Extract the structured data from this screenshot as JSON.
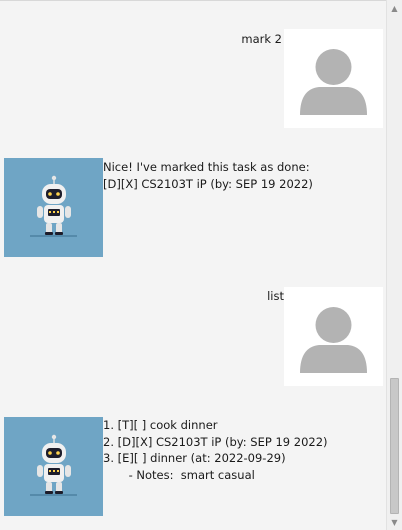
{
  "conversation": {
    "messages": [
      {
        "sender": "user",
        "text": "mark 2",
        "avatar_icon": "user-silhouette-icon"
      },
      {
        "sender": "bot",
        "text": "Nice! I've marked this task as done:\n[D][X] CS2103T iP (by: SEP 19 2022)",
        "avatar_icon": "robot-icon"
      },
      {
        "sender": "user",
        "text": "list",
        "avatar_icon": "user-silhouette-icon"
      },
      {
        "sender": "bot",
        "text": "1. [T][ ] cook dinner\n2. [D][X] CS2103T iP (by: SEP 19 2022)\n3. [E][ ] dinner (at: 2022-09-29)\n       - Notes:  smart casual",
        "avatar_icon": "robot-icon"
      }
    ]
  },
  "scrollbar": {
    "up_arrow_icon": "chevron-up-icon",
    "down_arrow_icon": "chevron-down-icon"
  },
  "colors": {
    "background": "#f4f4f4",
    "user_avatar_bg": "#ffffff",
    "user_silhouette": "#b3b3b3",
    "bot_avatar_bg": "#6fa5c5"
  }
}
